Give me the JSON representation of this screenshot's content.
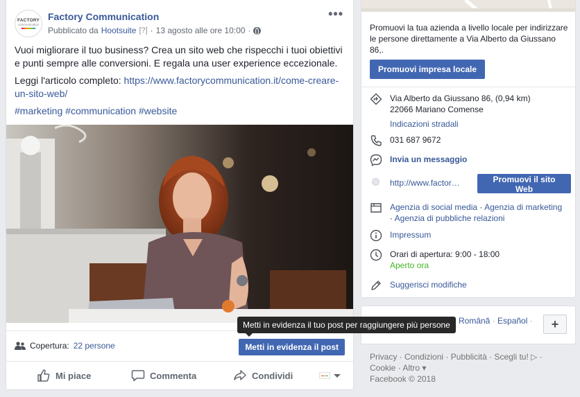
{
  "post": {
    "page_name": "Factory Communication",
    "avatar_text_1": "FACTORY",
    "avatar_text_2": "communication",
    "published_by_prefix": "Pubblicato da",
    "published_by": "Hootsuite",
    "help_mark": "[?]",
    "date_sep": "·",
    "date": "13 agosto alle ore 10:00",
    "date_sep2": "·",
    "more_label": "•••",
    "body_line1": "Vuoi migliorare il tuo business? Crea un sito web che rispecchi i tuoi obiettivi e punti sempre alle conversioni. E regala una user experience eccezionale.",
    "read_more_prefix": "Leggi l'articolo completo:",
    "link": "https://www.factorycommunication.it/come-creare-un-sito-web/",
    "hashtags": [
      "#marketing",
      "#communication",
      "#website"
    ],
    "reach_label": "Copertura:",
    "reach_value": "22 persone",
    "boost_button": "Metti in evidenza il post",
    "tooltip": "Metti in evidenza il tuo post per raggiungere più persone",
    "actions": {
      "like": "Mi piace",
      "comment": "Commenta",
      "share": "Condividi"
    }
  },
  "sidebar": {
    "promo_text": "Promuovi la tua azienda a livello locale per indirizzare le persone direttamente a Via Alberto da Giussano 86,.",
    "promo_button": "Promuovi impresa locale",
    "address_line1": "Via Alberto da Giussano 86, (0,94 km)",
    "address_line2": "22066 Mariano Comense",
    "directions": "Indicazioni stradali",
    "phone": "031 687 9672",
    "message": "Invia un messaggio",
    "website": "http://www.factor…",
    "website_button": "Promuovi il sito Web",
    "categories": [
      "Agenzia di social media",
      "Agenzia di marketing",
      "Agenzia di pubbliche relazioni"
    ],
    "cat_sep": " · ",
    "impressum": "Impressum",
    "hours": "Orari di apertura: 9:00 - 18:00",
    "open_now": "Aperto ora",
    "suggest_edits": "Suggerisci modifiche"
  },
  "languages": {
    "items": [
      "Română",
      "Español"
    ],
    "sep": " · ",
    "more": "+"
  },
  "footer": {
    "links": [
      "Privacy",
      "Condizioni",
      "Pubblicità",
      "Scegli tu!",
      "Cookie",
      "Altro"
    ],
    "copyright": "Facebook © 2018"
  },
  "colors": {
    "fb_blue": "#4267b2",
    "link": "#385898",
    "open_green": "#42b72a",
    "background": "#e9ebee"
  }
}
